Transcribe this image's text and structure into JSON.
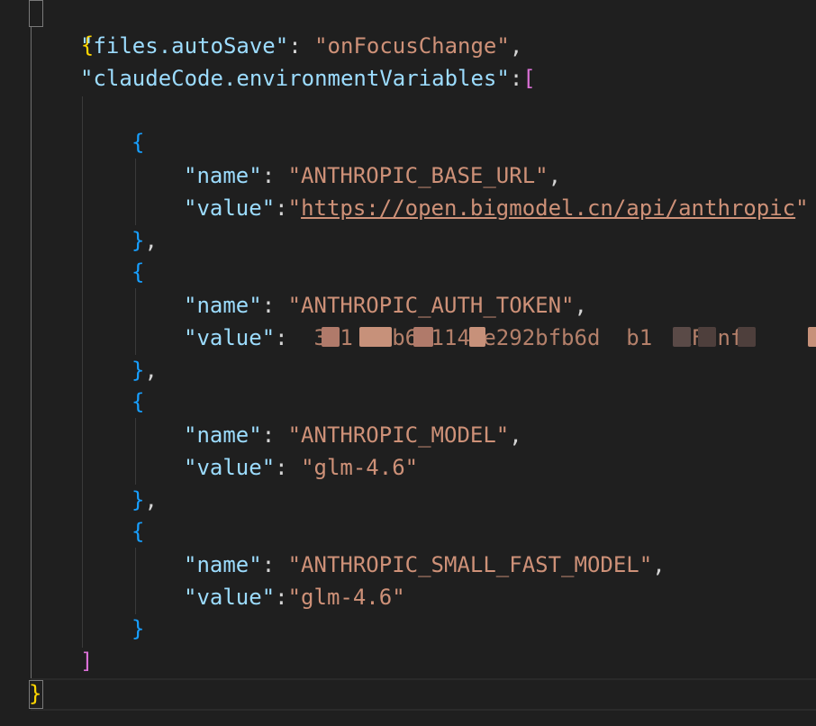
{
  "settings": {
    "open_brace": "{",
    "close_brace": "}",
    "auto_save": {
      "key": "\"files.autoSave\"",
      "value": "\"onFocusChange\""
    },
    "env_vars": {
      "key": "\"claudeCode.environmentVariables\"",
      "open_bracket": "[",
      "close_bracket": "]",
      "items": [
        {
          "name_key": "\"name\"",
          "name": "\"ANTHROPIC_BASE_URL\"",
          "value_key": "\"value\"",
          "value_open_quote": "\"",
          "value": "https://open.bigmodel.cn/api/anthropic",
          "value_close_quote": "\""
        },
        {
          "name_key": "\"name\"",
          "name": "\"ANTHROPIC_AUTH_TOKEN\"",
          "value_key": "\"value\"",
          "value": "3.1  7b681147e292bfb6d  b1  KFJnf0"
        },
        {
          "name_key": "\"name\"",
          "name": "\"ANTHROPIC_MODEL\"",
          "value_key": "\"value\"",
          "value": "\"glm-4.6\""
        },
        {
          "name_key": "\"name\"",
          "name": "\"ANTHROPIC_SMALL_FAST_MODEL\"",
          "value_key": "\"value\"",
          "value": "\"glm-4.6\""
        }
      ]
    }
  },
  "colors": {
    "background": "#1f1f1f",
    "key": "#9cdcfe",
    "string": "#ce9178",
    "bracket_level1": "#ffd700",
    "bracket_level2": "#da70d6",
    "bracket_level3": "#179fff",
    "redaction": "#c7917a"
  }
}
